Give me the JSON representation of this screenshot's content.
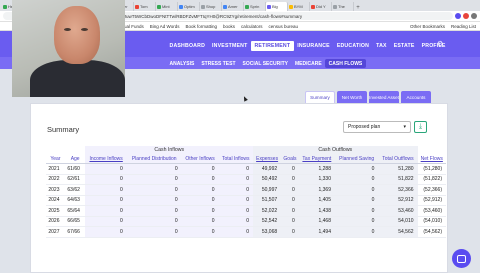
{
  "browser": {
    "tabs": [
      "Hea",
      "Buck",
      "Untit",
      "Ma",
      "Natur",
      "Amer",
      "Tom",
      "Mint",
      "Optim",
      "Shop",
      "Amer",
      "Sprin",
      "Big",
      "BYM",
      "Did Y",
      "The"
    ],
    "tab_colors": [
      "#34a853",
      "#fbbc04",
      "#34a853",
      "#4285f4",
      "#9aa0a6",
      "#4285f4",
      "#ea4335",
      "#34a853",
      "#4285f4",
      "#9aa0a6",
      "#4285f4",
      "#34a853",
      "#6a5cf0",
      "#fbbc04",
      "#ea4335",
      "#9aa0a6"
    ],
    "address": "FJuwT5WCbDwoDFNtTTw/RBDFZvMFTIqYH0@RC9ZYg/retirement/cash-flows#summary",
    "bookmarks": [
      "ual Funds",
      "Bing Ad Words",
      "Book formatting",
      "books",
      "calculators",
      "census bureau"
    ],
    "bookmarks_right": [
      "Other Bookmarks",
      "Reading List"
    ]
  },
  "nav": {
    "items": [
      "DASHBOARD",
      "INVESTMENT",
      "RETIREMENT",
      "INSURANCE",
      "EDUCATION",
      "TAX",
      "ESTATE",
      "PROFILE"
    ],
    "active_index": 2,
    "settings_icon": "gear-icon"
  },
  "subnav": {
    "items": [
      "ANALYSIS",
      "STRESS TEST",
      "SOCIAL SECURITY",
      "MEDICARE",
      "CASH FLOWS"
    ],
    "active_index": 4
  },
  "page_tabs": {
    "items": [
      "Summary",
      "Net Worth",
      "Invested Asset",
      "Accounts"
    ],
    "active_index": 0
  },
  "summary": {
    "title": "Summary",
    "plan_select": "Proposed plan",
    "export_icon": "download-icon"
  },
  "table": {
    "groups": {
      "inflows": "Cash Inflows",
      "outflows": "Cash Outflows"
    },
    "headers": [
      "Year",
      "Age",
      "Income Inflows",
      "Planned Distribution",
      "Other Inflows",
      "Total Inflows",
      "Expenses",
      "Goals",
      "Tax Payment",
      "Planned Saving",
      "Total Outflows",
      "Net Flows"
    ],
    "rows": [
      [
        "2021",
        "61/60",
        "0",
        "0",
        "0",
        "0",
        "49,992",
        "0",
        "1,288",
        "0",
        "51,280",
        "(51,280)"
      ],
      [
        "2022",
        "62/61",
        "0",
        "0",
        "0",
        "0",
        "50,492",
        "0",
        "1,330",
        "0",
        "51,822",
        "(51,822)"
      ],
      [
        "2023",
        "63/62",
        "0",
        "0",
        "0",
        "0",
        "50,997",
        "0",
        "1,369",
        "0",
        "52,366",
        "(52,366)"
      ],
      [
        "2024",
        "64/63",
        "0",
        "0",
        "0",
        "0",
        "51,507",
        "0",
        "1,405",
        "0",
        "52,912",
        "(52,912)"
      ],
      [
        "2025",
        "65/64",
        "0",
        "0",
        "0",
        "0",
        "52,022",
        "0",
        "1,438",
        "0",
        "53,460",
        "(53,460)"
      ],
      [
        "2026",
        "66/65",
        "0",
        "0",
        "0",
        "0",
        "52,542",
        "0",
        "1,468",
        "0",
        "54,010",
        "(54,010)"
      ],
      [
        "2027",
        "67/66",
        "0",
        "0",
        "0",
        "0",
        "53,068",
        "0",
        "1,494",
        "0",
        "54,562",
        "(54,562)"
      ]
    ]
  }
}
